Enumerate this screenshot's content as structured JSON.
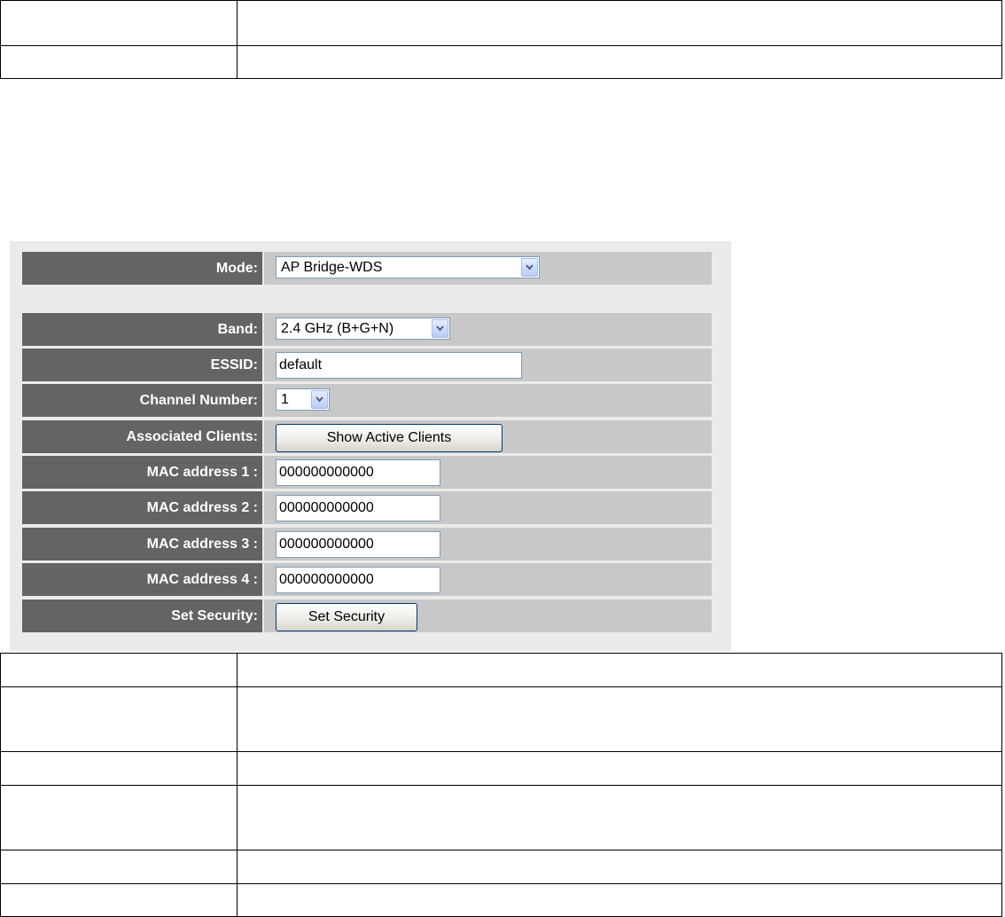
{
  "form": {
    "mode": {
      "label": "Mode:",
      "value": "AP Bridge-WDS"
    },
    "band": {
      "label": "Band:",
      "value": "2.4 GHz (B+G+N)"
    },
    "essid": {
      "label": "ESSID:",
      "value": "default"
    },
    "channel": {
      "label": "Channel Number:",
      "value": "1"
    },
    "clients": {
      "label": "Associated Clients:",
      "button": "Show Active Clients"
    },
    "mac1": {
      "label": "MAC address 1 :",
      "value": "000000000000"
    },
    "mac2": {
      "label": "MAC address 2 :",
      "value": "000000000000"
    },
    "mac3": {
      "label": "MAC address 3 :",
      "value": "000000000000"
    },
    "mac4": {
      "label": "MAC address 4 :",
      "value": "000000000000"
    },
    "security": {
      "label": "Set Security:",
      "button": "Set Security"
    }
  },
  "icons": {
    "dropdown": "chevron-down-icon"
  },
  "colors": {
    "label_bg": "#646464",
    "value_bg": "#c8c8c8",
    "panel_bg": "#ebebeb",
    "label_text": "#ffffff"
  }
}
